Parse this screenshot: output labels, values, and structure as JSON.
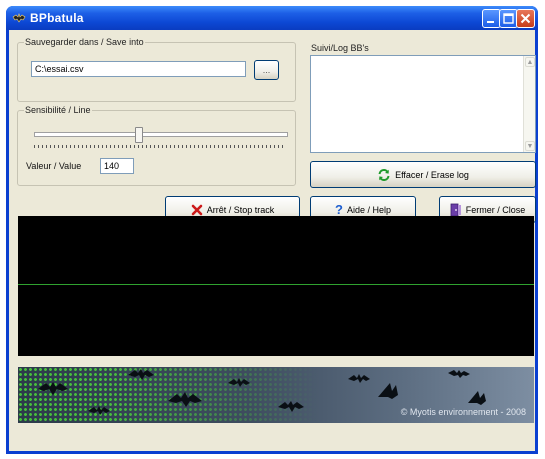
{
  "window": {
    "title": "BPbatula"
  },
  "save_group": {
    "label": "Sauvegarder dans / Save into",
    "path_value": "C:\\essai.csv",
    "browse_label": "..."
  },
  "sensitivity_group": {
    "label": "Sensibilité / Line",
    "value_label": "Valeur / Value",
    "value": "140",
    "level_fraction": 0.41
  },
  "log_group": {
    "label": "Suivi/Log BB's"
  },
  "buttons": {
    "erase": "Effacer / Erase log",
    "stop": "Arrêt / Stop track",
    "help": "Aide / Help",
    "close": "Fermer / Close"
  },
  "banner": {
    "copyright": "© Myotis environnement - 2008"
  },
  "colors": {
    "titlebar": "#0c47d3",
    "client": "#ece9d8",
    "scope_bg": "#000000",
    "scope_trace": "#2fa22f",
    "banner_dots": "#4bd43a"
  },
  "icons": {
    "stop": "red-x-icon",
    "help": "question-mark-icon",
    "erase": "refresh-arrows-icon",
    "close": "exit-door-icon",
    "app": "bat-icon"
  }
}
